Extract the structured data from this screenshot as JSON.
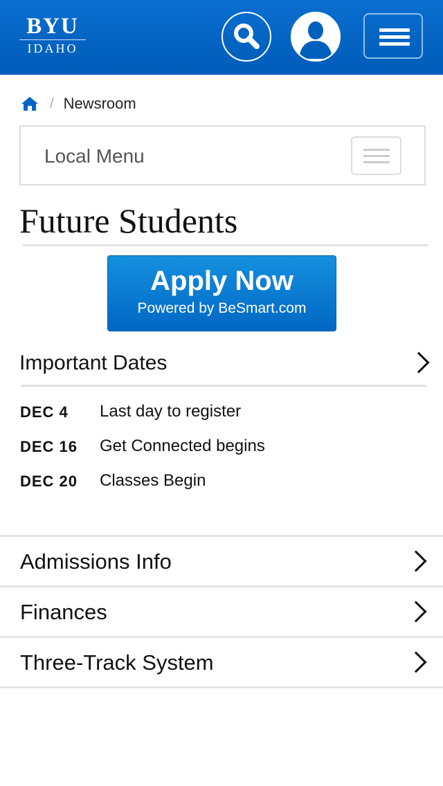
{
  "header": {
    "logo": {
      "main": "BYU",
      "sub": "IDAHO"
    },
    "search_icon": "search-icon",
    "user_icon": "user-icon",
    "menu_icon": "hamburger-icon",
    "brand_color": "#0066c4"
  },
  "breadcrumb": {
    "home_icon": "home-icon",
    "separator": "/",
    "current": "Newsroom"
  },
  "local_menu": {
    "label": "Local Menu",
    "toggle_icon": "hamburger-icon"
  },
  "page": {
    "title": "Future Students"
  },
  "apply": {
    "label": "Apply Now",
    "sublabel": "Powered by BeSmart.com"
  },
  "important_dates": {
    "heading": "Important Dates",
    "items": [
      {
        "date": "DEC 4",
        "desc": "Last day to register"
      },
      {
        "date": "DEC 16",
        "desc": "Get Connected begins"
      },
      {
        "date": "DEC 20",
        "desc": "Classes Begin"
      }
    ]
  },
  "nav": {
    "items": [
      {
        "label": "Admissions Info"
      },
      {
        "label": "Finances"
      },
      {
        "label": "Three-Track System"
      }
    ]
  }
}
